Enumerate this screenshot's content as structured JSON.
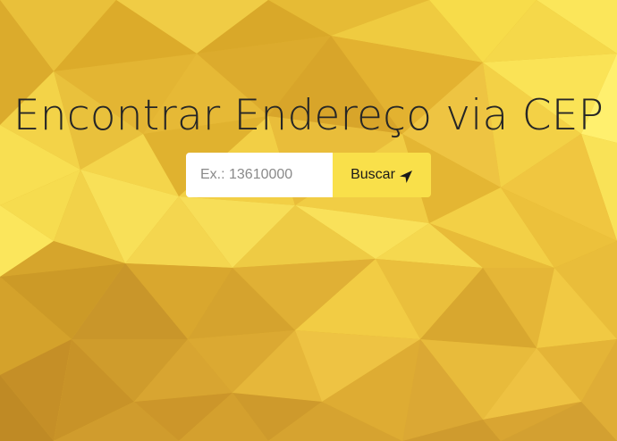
{
  "page": {
    "title": "Encontrar Endereço via CEP",
    "background_color": "#e0b22f"
  },
  "search": {
    "placeholder": "Ex.: 13610000",
    "value": "",
    "button_label": "Buscar",
    "button_icon": "location-arrow-icon",
    "button_color": "#f9e04a"
  }
}
